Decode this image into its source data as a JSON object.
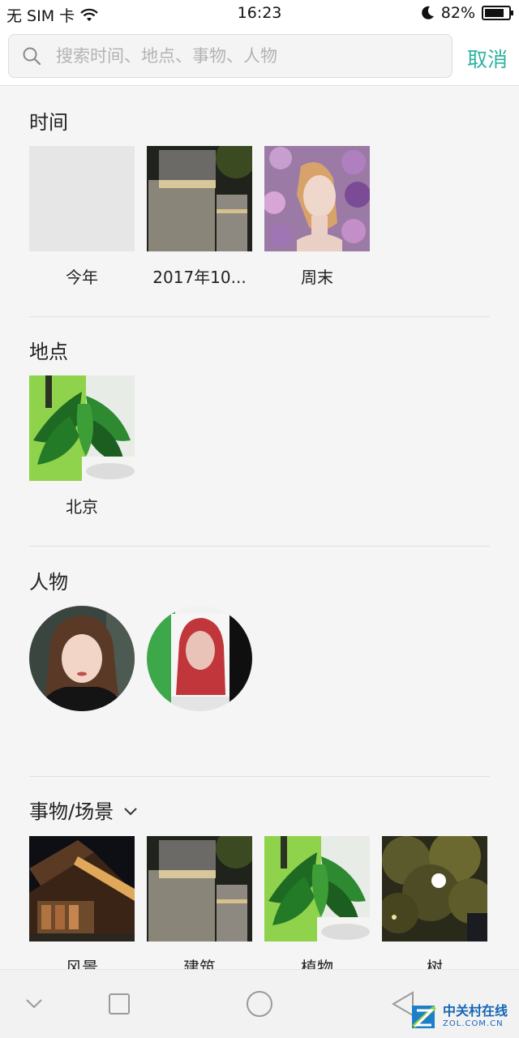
{
  "status_bar": {
    "carrier": "无 SIM 卡",
    "time": "16:23",
    "battery_text": "82%",
    "battery_level": 0.82
  },
  "search": {
    "placeholder": "搜索时间、地点、事物、人物",
    "value": "",
    "cancel_label": "取消"
  },
  "sections": {
    "time": {
      "title": "时间",
      "items": [
        {
          "label": "今年",
          "icon": "blank-thumbnail"
        },
        {
          "label": "2017年10...",
          "icon": "building-photo"
        },
        {
          "label": "周末",
          "icon": "portrait-flowers-photo"
        }
      ]
    },
    "place": {
      "title": "地点",
      "items": [
        {
          "label": "北京",
          "icon": "plant-photo"
        }
      ]
    },
    "people": {
      "title": "人物",
      "items": [
        {
          "icon": "woman-face"
        },
        {
          "icon": "photo-face"
        }
      ]
    },
    "things": {
      "title": "事物/场景",
      "items": [
        {
          "label": "风景",
          "icon": "street-night-photo"
        },
        {
          "label": "建筑",
          "icon": "building-photo"
        },
        {
          "label": "植物",
          "icon": "plant-photo"
        },
        {
          "label": "树",
          "icon": "tree-night-photo"
        }
      ]
    }
  },
  "watermark": {
    "main": "中关村在线",
    "sub": "ZOL.COM.CN"
  },
  "colors": {
    "accent": "#2db3a0",
    "background": "#f5f5f5"
  }
}
